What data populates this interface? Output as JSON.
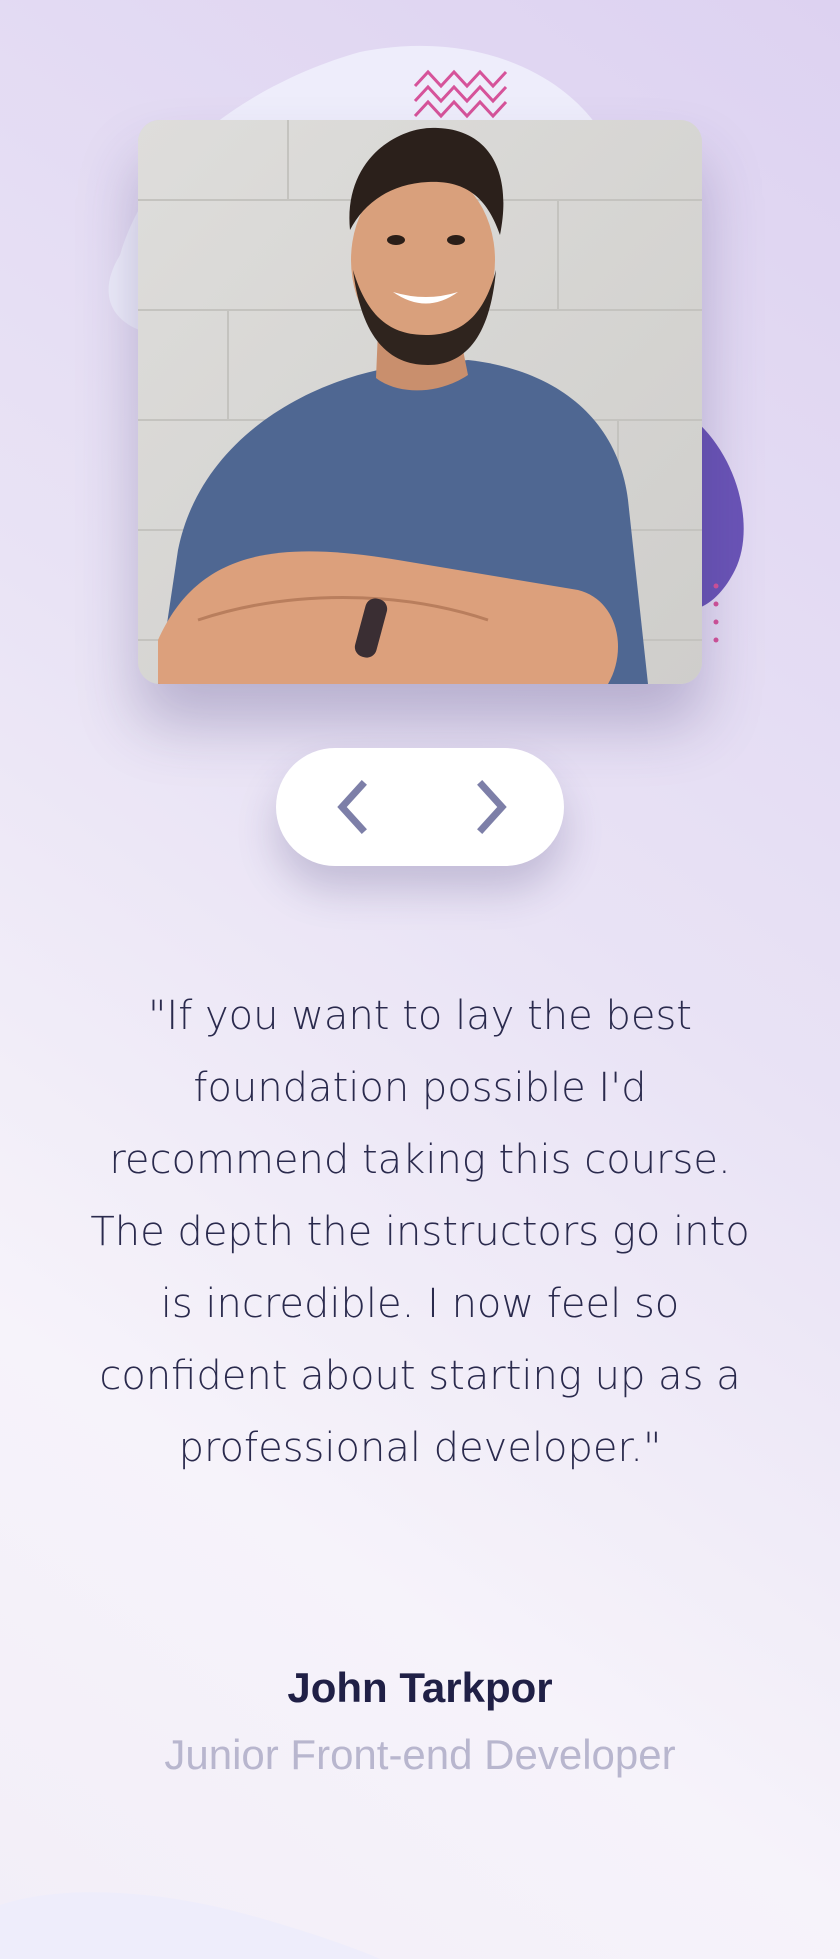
{
  "testimonial": {
    "quote": "\"If you want to lay the best foundation possible I'd recommend taking this course. The depth the instructors go into is incredible. I now feel so confident about starting up as a professional developer.\"",
    "name": "John Tarkpor",
    "role": "Junior Front-end Developer"
  },
  "navigation": {
    "prev_icon": "chevron-left-icon",
    "next_icon": "chevron-right-icon"
  },
  "colors": {
    "text_dark": "#202046",
    "text_muted": "#b8b6ce",
    "accent_purple": "#6a54b7",
    "accent_pink": "#d6539a",
    "nav_arrow": "#7d7fa8"
  }
}
